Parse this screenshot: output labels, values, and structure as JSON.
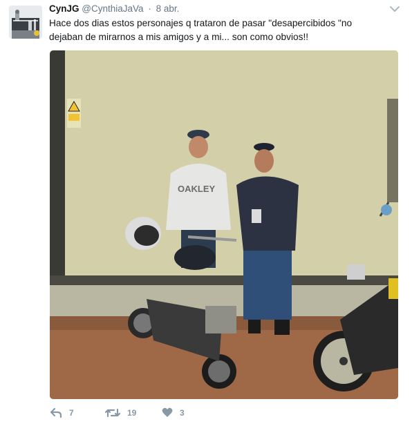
{
  "tweet": {
    "fullname": "CynJG",
    "handle": "@CynthiaJaVa",
    "dot": "·",
    "time": "8 abr.",
    "text": "Hace dos dias estos personajes q trataron de pasar \"desapercibidos \"no dejaban de mirarnos a mis amigos y a mi...  son como obvios!!",
    "image_description_icons": [
      "warning-sign"
    ],
    "actions": {
      "reply_count": "7",
      "retweet_count": "19",
      "like_count": "3"
    },
    "icons": {
      "reply": "reply-icon",
      "retweet": "retweet-icon",
      "like": "heart-icon",
      "menu": "chevron-down-icon"
    },
    "colors": {
      "text": "#14171a",
      "muted": "#657786",
      "action": "#8899a6",
      "wall": "#cfcca8"
    }
  }
}
